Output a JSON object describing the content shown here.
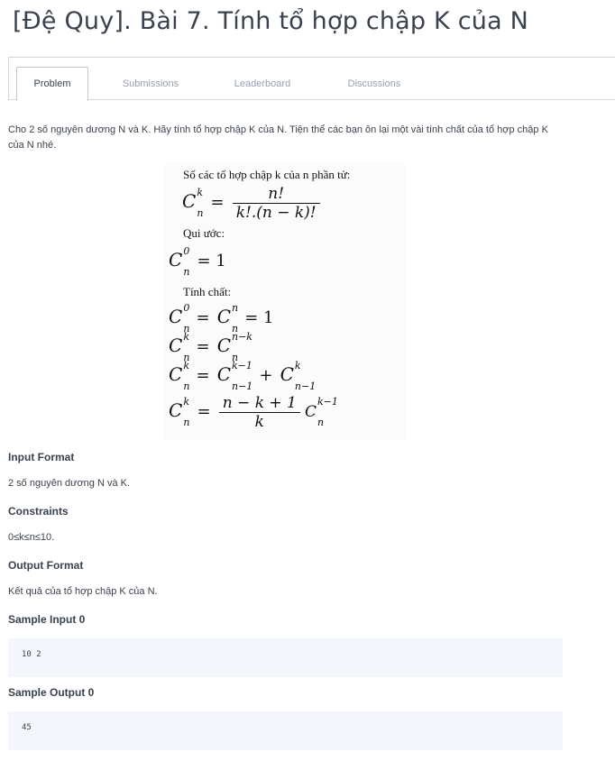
{
  "page": {
    "title": "[Đệ Quy]. Bài 7. Tính tổ hợp chập K của N"
  },
  "tabs": [
    {
      "label": "Problem",
      "active": true
    },
    {
      "label": "Submissions",
      "active": false
    },
    {
      "label": "Leaderboard",
      "active": false
    },
    {
      "label": "Discussions",
      "active": false
    }
  ],
  "problem": {
    "description": "Cho 2 số nguyên dương N và K. Hãy tính tổ hợp chập K của N. Tiện thể các bạn ôn lại một vài tính chất của tổ hợp chập K của N nhé.",
    "formula_image": {
      "heading": "Số các tổ hợp chập k của n phần tử:",
      "convention_label": "Qui ước:",
      "properties_label": "Tính chất:"
    }
  },
  "sections": {
    "input_format": {
      "title": "Input Format",
      "text": "2 số nguyên dương N và K."
    },
    "constraints": {
      "title": "Constraints",
      "text": "0≤k≤n≤10."
    },
    "output_format": {
      "title": "Output Format",
      "text": "Kết quả của tổ hợp chập K của N."
    },
    "sample_input": {
      "title": "Sample Input 0",
      "code": "10 2"
    },
    "sample_output": {
      "title": "Sample Output 0",
      "code": "45"
    }
  },
  "colors": {
    "text": "#39424e",
    "muted": "#979faf",
    "border": "#d3d7dc",
    "code_bg": "#f3f6fa"
  }
}
